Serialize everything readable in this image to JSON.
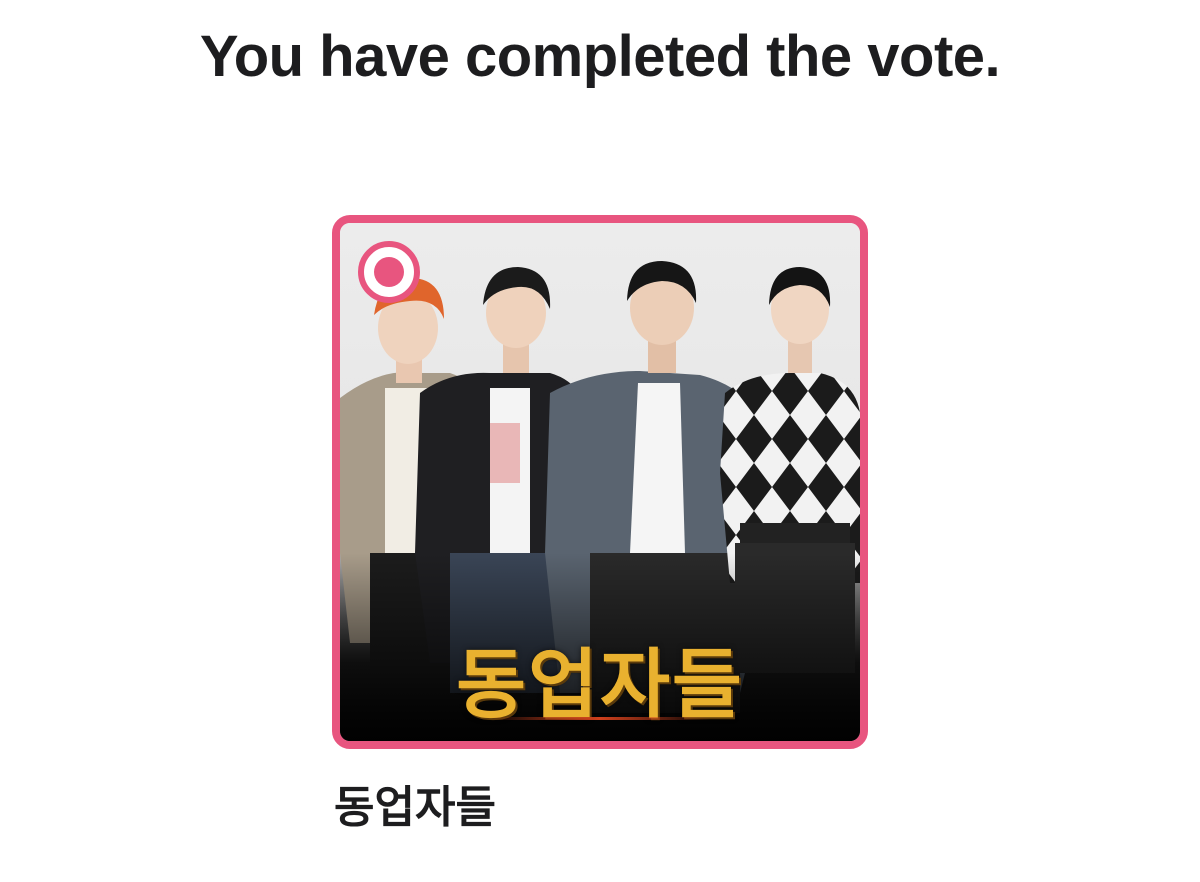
{
  "header": {
    "title": "You have completed the vote."
  },
  "candidate": {
    "name": "동업자들",
    "poster_logo_text": "동업자들",
    "selected": true
  },
  "colors": {
    "accent": "#e8557f",
    "title_text": "#1d1d1f",
    "poster_logo": "#e9b12f",
    "background": "#ffffff"
  },
  "icons": {
    "selection_indicator": "radio-selected-icon"
  }
}
